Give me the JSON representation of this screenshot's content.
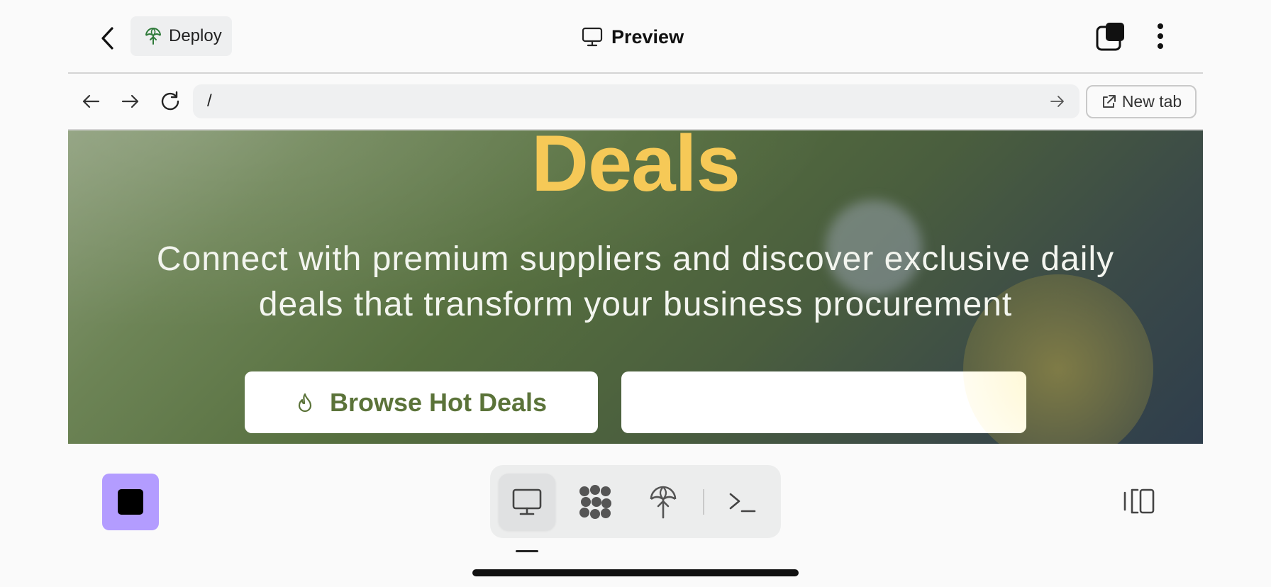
{
  "header": {
    "back_icon": "chevron-left-icon",
    "deploy_label": "Deploy",
    "deploy_icon": "umbrella-upload-icon",
    "title": "Preview",
    "title_icon": "monitor-icon",
    "tabs_icon": "tabs-icon",
    "more_icon": "vertical-dots-icon"
  },
  "browser": {
    "back_icon": "arrow-left-icon",
    "forward_icon": "arrow-right-icon",
    "reload_icon": "reload-icon",
    "url": "/",
    "go_icon": "arrow-right-icon",
    "new_tab_label": "New tab",
    "new_tab_icon": "external-link-icon"
  },
  "page": {
    "headline": "Deals",
    "tagline_line1": "Connect with premium suppliers and discover exclusive daily",
    "tagline_line2": "deals that transform your business procurement",
    "primary_button": "Browse Hot Deals",
    "primary_button_icon": "flame-icon",
    "secondary_button": ""
  },
  "bottom": {
    "stop_icon": "stop-icon",
    "tools": [
      {
        "name": "preview",
        "icon": "monitor-icon",
        "active": true
      },
      {
        "name": "assets",
        "icon": "cluster-icon",
        "active": false
      },
      {
        "name": "deploy",
        "icon": "umbrella-upload-icon",
        "active": false
      },
      {
        "name": "terminal",
        "icon": "terminal-icon",
        "active": false
      }
    ],
    "panel_icon": "split-panel-icon"
  },
  "colors": {
    "accent_purple": "#b39cff",
    "headline_yellow": "#f6c957",
    "button_green_text": "#5b7339",
    "hero_green": "#566f3f",
    "hero_slate": "#2f3e4c"
  }
}
